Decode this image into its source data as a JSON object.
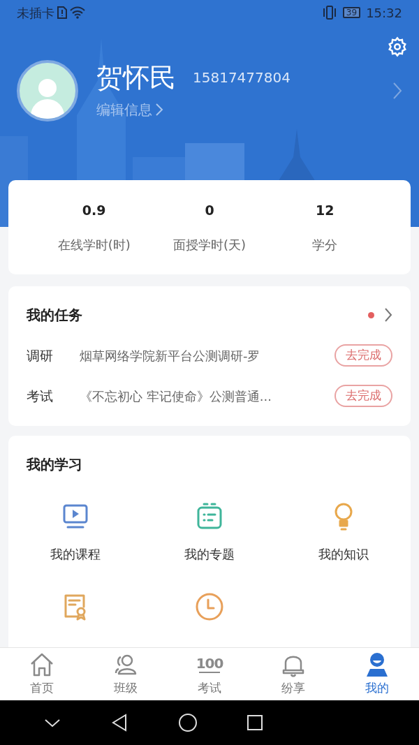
{
  "status_bar": {
    "carrier": "未插卡",
    "battery": "39",
    "time": "15:32"
  },
  "profile": {
    "name": "贺怀民",
    "phone": "15817477804",
    "edit_link": "编辑信息"
  },
  "stats": [
    {
      "value": "0.9",
      "label": "在线学时(时)"
    },
    {
      "value": "0",
      "label": "面授学时(天)"
    },
    {
      "value": "12",
      "label": "学分"
    }
  ],
  "tasks": {
    "title": "我的任务",
    "unread": true,
    "items": [
      {
        "type": "调研",
        "title": "烟草网络学院新平台公测调研-罗",
        "action": "去完成"
      },
      {
        "type": "考试",
        "title": "《不忘初心 牢记使命》公测普通...",
        "action": "去完成"
      }
    ]
  },
  "learning": {
    "title": "我的学习",
    "items": [
      {
        "kind": "course",
        "label": "我的课程"
      },
      {
        "kind": "topic",
        "label": "我的专题"
      },
      {
        "kind": "knowledge",
        "label": "我的知识"
      },
      {
        "kind": "certificate"
      },
      {
        "kind": "clock"
      }
    ]
  },
  "tab_bar": [
    {
      "kind": "home",
      "label": "首页",
      "selected": false
    },
    {
      "kind": "class",
      "label": "班级",
      "selected": false
    },
    {
      "kind": "exam",
      "icon_text": "100",
      "label": "考试",
      "selected": false
    },
    {
      "kind": "bell",
      "label": "纷享",
      "selected": false
    },
    {
      "kind": "me",
      "label": "我的",
      "selected": true
    }
  ]
}
